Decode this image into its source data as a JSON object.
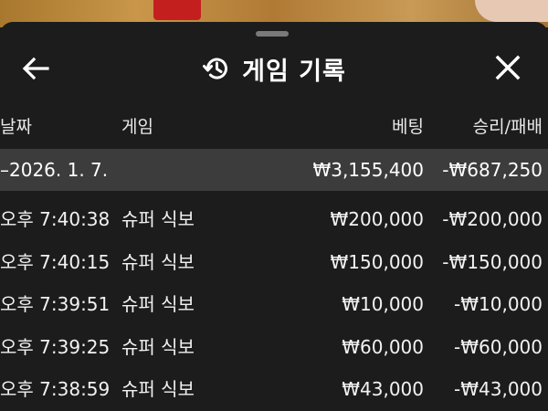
{
  "header": {
    "title": "게임 기록",
    "icons": {
      "back": "arrow-left-icon",
      "history": "history-icon",
      "close": "close-icon"
    }
  },
  "columns": {
    "date": "날짜",
    "game": "게임",
    "bet": "베팅",
    "result": "승리/패배"
  },
  "summary": {
    "date": "–2026. 1. 7.",
    "bet": "₩3,155,400",
    "result": "-₩687,250"
  },
  "rows": [
    {
      "time": "오후 7:40:38",
      "game": "슈퍼 식보",
      "bet": "₩200,000",
      "result": "-₩200,000"
    },
    {
      "time": "오후 7:40:15",
      "game": "슈퍼 식보",
      "bet": "₩150,000",
      "result": "-₩150,000"
    },
    {
      "time": "오후 7:39:51",
      "game": "슈퍼 식보",
      "bet": "₩10,000",
      "result": "-₩10,000"
    },
    {
      "time": "오후 7:39:25",
      "game": "슈퍼 식보",
      "bet": "₩60,000",
      "result": "-₩60,000"
    },
    {
      "time": "오후 7:38:59",
      "game": "슈퍼 식보",
      "bet": "₩43,000",
      "result": "-₩43,000"
    }
  ],
  "colors": {
    "sheet_background": "#1c1c1c",
    "summary_background": "#3c3c3c",
    "text": "#ffffff"
  }
}
